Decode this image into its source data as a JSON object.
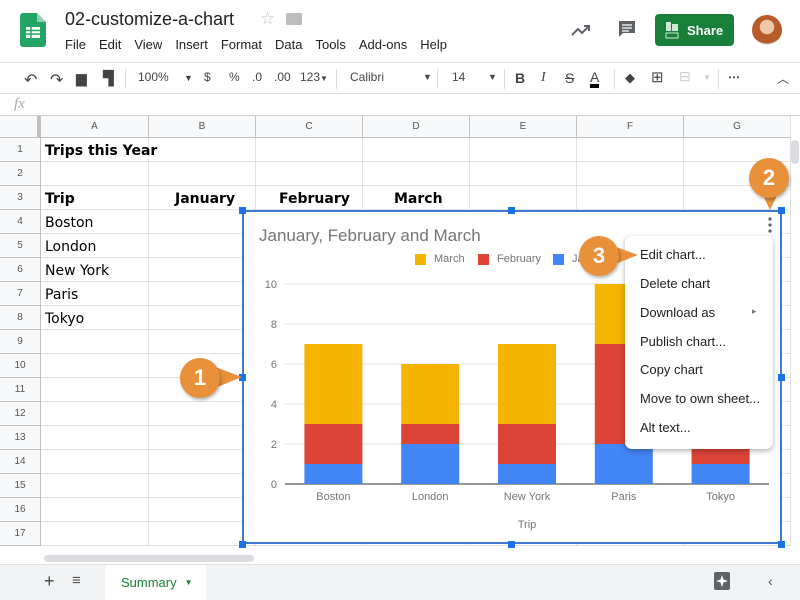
{
  "header": {
    "doc_title": "02-customize-a-chart",
    "menu": [
      "File",
      "Edit",
      "View",
      "Insert",
      "Format",
      "Data",
      "Tools",
      "Add-ons",
      "Help"
    ],
    "share_label": "Share"
  },
  "toolbar": {
    "zoom": "100%",
    "currency": "$",
    "percent": "%",
    "dec_decrease": ".0",
    "dec_increase": ".00",
    "format_more": "123",
    "font": "Calibri",
    "font_size": "14",
    "bold": "B",
    "italic": "I",
    "strike": "S",
    "text_color": "A",
    "more": "⋯"
  },
  "formula": {
    "fx": "fx"
  },
  "grid": {
    "columns": [
      "A",
      "B",
      "C",
      "D",
      "E",
      "F",
      "G"
    ],
    "rows": [
      "1",
      "2",
      "3",
      "4",
      "5",
      "6",
      "7",
      "8",
      "9",
      "10",
      "11",
      "12",
      "13",
      "14",
      "15",
      "16",
      "17"
    ],
    "cells": {
      "A1": "Trips this Year",
      "A3": "Trip",
      "B3": "January",
      "C3": "February",
      "D3": "March",
      "A4": "Boston",
      "A5": "London",
      "A6": "New York",
      "A7": "Paris",
      "A8": "Tokyo"
    }
  },
  "chart_data": {
    "type": "bar",
    "stacked": true,
    "title": "January, February and March",
    "xlabel": "Trip",
    "ylabel": "",
    "categories": [
      "Boston",
      "London",
      "New York",
      "Paris",
      "Tokyo"
    ],
    "series": [
      {
        "name": "January",
        "color": "#4285f4",
        "values": [
          1,
          2,
          1,
          2,
          1
        ]
      },
      {
        "name": "February",
        "color": "#db4437",
        "values": [
          2,
          1,
          2,
          5,
          1
        ]
      },
      {
        "name": "March",
        "color": "#f4b400",
        "values": [
          4,
          3,
          4,
          3,
          0
        ]
      }
    ],
    "legend": [
      "March",
      "February",
      "January"
    ],
    "legend_visible": [
      "March",
      "February",
      "Ja"
    ],
    "legend_position": "top-right",
    "yticks": [
      0,
      2,
      4,
      6,
      8,
      10
    ],
    "ylim": [
      0,
      10
    ],
    "grid": true
  },
  "context_menu": {
    "items": [
      "Edit chart...",
      "Delete chart",
      "Download as",
      "Publish chart...",
      "Copy chart",
      "Move to own sheet...",
      "Alt text..."
    ],
    "submenu_arrow": "▸"
  },
  "callouts": [
    "1",
    "2",
    "3"
  ],
  "sheets": {
    "active": "Summary"
  }
}
